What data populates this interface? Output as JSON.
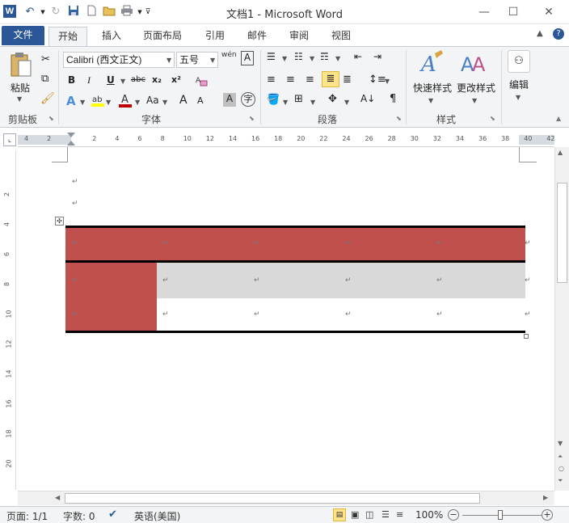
{
  "window": {
    "title": "文档1  -  Microsoft Word"
  },
  "tabs": [
    "文件",
    "开始",
    "插入",
    "页面布局",
    "引用",
    "邮件",
    "审阅",
    "视图"
  ],
  "ribbon": {
    "clipboard": {
      "paste": "粘贴",
      "group": "剪贴板"
    },
    "font": {
      "name": "Calibri (西文正文)",
      "size": "五号",
      "wen": "wén",
      "bold": "B",
      "italic": "I",
      "underline": "U",
      "strike": "abc",
      "sub": "x₂",
      "sup": "x²",
      "fontcolor": "A",
      "aa": "Aa",
      "grow": "A",
      "shrink": "A",
      "group": "字体"
    },
    "paragraph": {
      "group": "段落"
    },
    "styles": {
      "quick": "快速样式",
      "change": "更改样式",
      "group": "样式"
    },
    "editing": {
      "label": "编辑"
    }
  },
  "ruler": {
    "h": [
      "4",
      "2",
      "",
      "2",
      "4",
      "6",
      "8",
      "10",
      "12",
      "14",
      "16",
      "18",
      "20",
      "22",
      "24",
      "26",
      "28",
      "30",
      "32",
      "34",
      "36",
      "38",
      "40",
      "42"
    ],
    "v": [
      "2",
      "4",
      "6",
      "8",
      "10",
      "12",
      "14",
      "16",
      "18",
      "20"
    ]
  },
  "document": {
    "paragraph_mark": "↵",
    "cell_mark": "↵",
    "table": {
      "rows": 3,
      "cols": 5,
      "header_color": "#c0504d",
      "row2_color": "#d9d9d9"
    }
  },
  "status": {
    "page": "页面: 1/1",
    "words": "字数: 0",
    "lang": "英语(美国)",
    "zoom": "100%"
  },
  "colors": {
    "accent": "#2b5797",
    "table_red": "#c0504d"
  }
}
